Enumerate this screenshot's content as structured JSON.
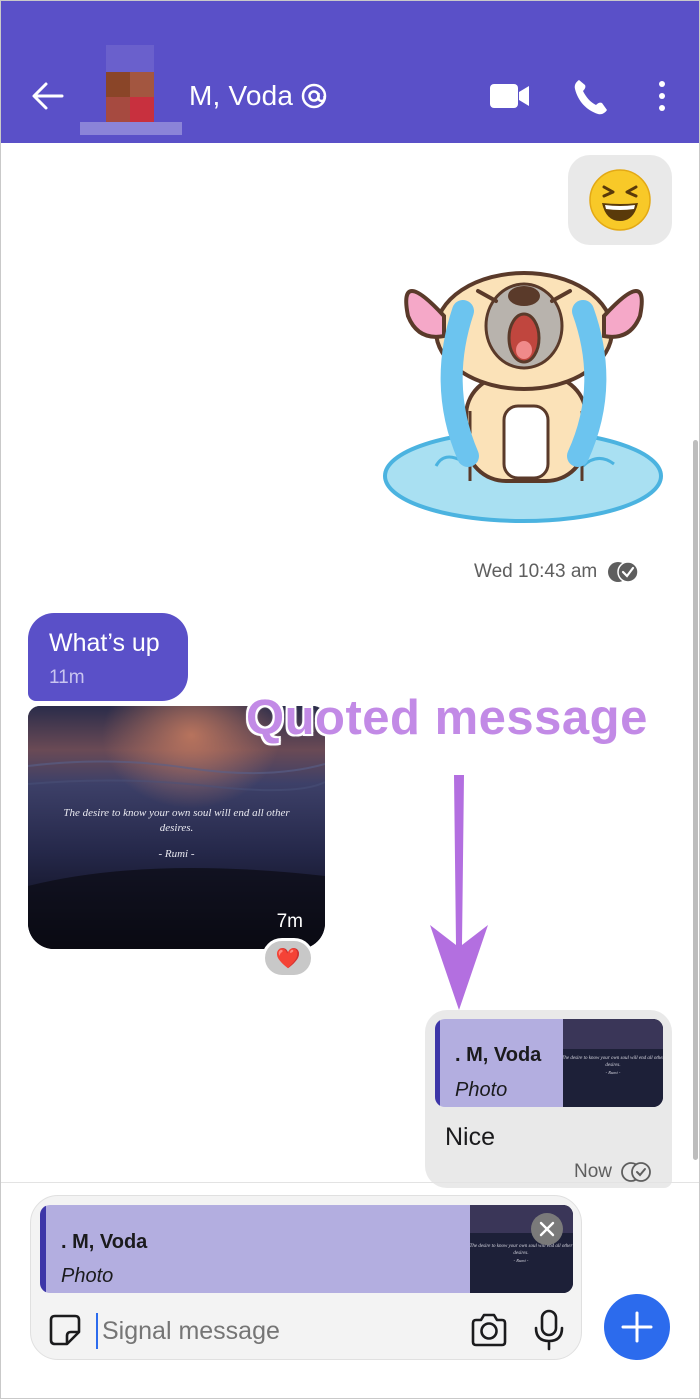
{
  "header": {
    "contact_name": "M, Voda",
    "icons": [
      "back-arrow-icon",
      "avatar",
      "note-to-self-icon",
      "video-call-icon",
      "voice-call-icon",
      "more-vert-icon"
    ],
    "background": "#5a50c8"
  },
  "messages": {
    "emoji": "😆",
    "sticker_timestamp": "Wed 10:43 am",
    "incoming_text": "What’s up",
    "incoming_time": "11m",
    "photo_quote": "The desire to know your own soul will end all other desires.",
    "photo_author": "- Rumi -",
    "photo_time": "7m",
    "reaction": "❤️",
    "reply": {
      "quoted_author": ". M, Voda",
      "quoted_type": "Photo",
      "text": "Nice",
      "time": "Now"
    }
  },
  "annotation": {
    "label": "Quoted message",
    "color": "#c28ae6"
  },
  "composer": {
    "quoted_author": ". M, Voda",
    "quoted_type": "Photo",
    "placeholder": "Signal message",
    "accent": "#2c6bed"
  }
}
